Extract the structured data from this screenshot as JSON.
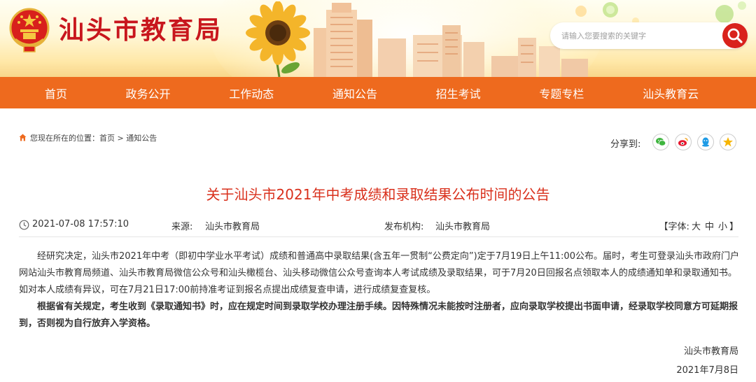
{
  "header": {
    "site_title": "汕头市教育局",
    "search_placeholder": "请输入您要搜索的关键字"
  },
  "nav": {
    "items": [
      "首页",
      "政务公开",
      "工作动态",
      "通知公告",
      "招生考试",
      "专题专栏",
      "汕头教育云"
    ]
  },
  "breadcrumb": {
    "prefix": "您现在所在的位置：",
    "items": [
      "首页",
      "通知公告"
    ],
    "separator": ">"
  },
  "share": {
    "label": "分享到:",
    "targets": [
      "wechat-icon",
      "weibo-icon",
      "qq-icon",
      "qzone-icon"
    ]
  },
  "article": {
    "title": "关于汕头市2021年中考成绩和录取结果公布时间的公告",
    "date": "2021-07-08 17:57:10",
    "source_label": "来源:",
    "source": "汕头市教育局",
    "publisher_label": "发布机构:",
    "publisher": "汕头市教育局",
    "font_label": "【字体:",
    "font_sizes": [
      "大",
      "中",
      "小"
    ],
    "font_close": "】",
    "paragraph1": "经研究决定，汕头市2021年中考（即初中学业水平考试）成绩和普通高中录取结果(含五年一贯制“公费定向”)定于7月19日上午11:00公布。届时，考生可登录汕头市政府门户网站汕头市教育局频道、汕头市教育局微信公众号和汕头橄榄台、汕头移动微信公众号查询本人考试成绩及录取结果，可于7月20日回报名点领取本人的成绩通知单和录取通知书。如对本人成绩有异议，可在7月21日17:00前持准考证到报名点提出成绩复查申请，进行成绩复查复核。",
    "paragraph2": "根据省有关规定，考生收到《录取通知书》时，应在规定时间到录取学校办理注册手续。因特殊情况未能按时注册者，应向录取学校提出书面申请，经录取学校同意方可延期报到，否则视为自行放弃入学资格。",
    "sign_org": "汕头市教育局",
    "sign_date": "2021年7月8日"
  },
  "colors": {
    "brand_red": "#c8161d",
    "nav_orange": "#ee6a1e",
    "title_red": "#d9301c"
  }
}
